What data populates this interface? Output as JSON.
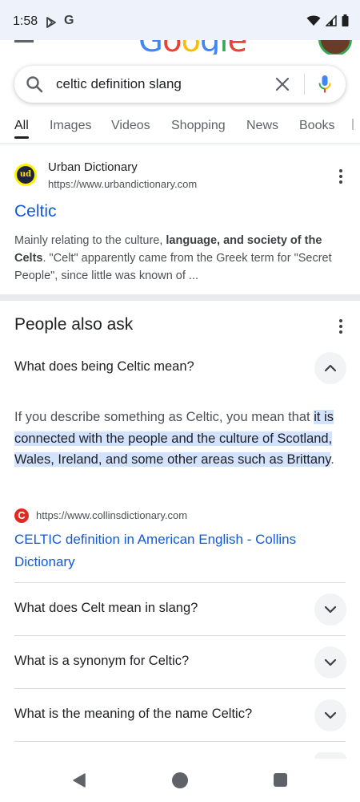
{
  "status_bar": {
    "time": "1:58",
    "g_label": "G"
  },
  "header": {
    "logo_text": "Google"
  },
  "search": {
    "query": "celtic definition slang"
  },
  "tabs": [
    {
      "label": "All",
      "active": true
    },
    {
      "label": "Images"
    },
    {
      "label": "Videos"
    },
    {
      "label": "Shopping"
    },
    {
      "label": "News"
    },
    {
      "label": "Books"
    }
  ],
  "result": {
    "logo_text": "ud",
    "site_name": "Urban Dictionary",
    "url": "https://www.urbandictionary.com",
    "title": "Celtic",
    "snippet_pre": "Mainly relating to the culture, ",
    "snippet_bold1": "language, and society of the Celts",
    "snippet_post": ". \"Celt\" apparently came from the Greek term for \"Secret People\", since little was known of ..."
  },
  "paa": {
    "title": "People also ask",
    "expanded_question": "What does being Celtic mean?",
    "answer_pre": "If you describe something as Celtic, you mean that ",
    "answer_highlight": "it is connected with the people and the culture of Scotland, Wales, Ireland, and some other areas such as Brittany",
    "answer_post": ".",
    "source_logo": "C",
    "source_url": "https://www.collinsdictionary.com",
    "source_title": "CELTIC definition in American English - Collins Dictionary",
    "questions": [
      "What does Celt mean in slang?",
      "What is a synonym for Celtic?",
      "What is the meaning of the name Celtic?"
    ]
  },
  "colors": {
    "link": "#1558d6",
    "highlight": "#d3e3fd",
    "status_bar_bg": "#eef2fa"
  }
}
